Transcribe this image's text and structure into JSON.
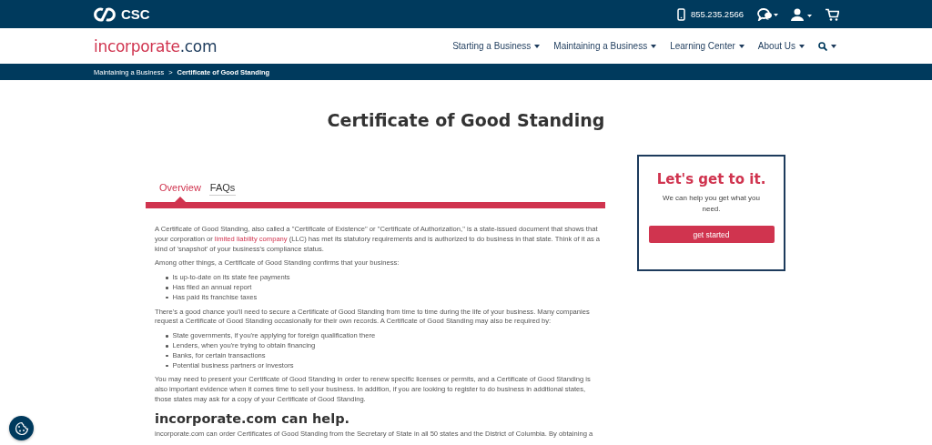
{
  "top_bar": {
    "logo": "CSC",
    "phone": "855.235.2566"
  },
  "nav": {
    "brand": [
      "incorporate",
      ".com"
    ],
    "items": [
      {
        "label": "Starting a Business"
      },
      {
        "label": "Maintaining a Business"
      },
      {
        "label": "Learning Center"
      },
      {
        "label": "About Us"
      }
    ]
  },
  "breadcrumb": {
    "separator": ">",
    "items": [
      {
        "label": "Maintaining a Business",
        "current": false
      },
      {
        "label": "Certificate of Good Standing",
        "current": true
      }
    ]
  },
  "title": "Certificate of Good Standing",
  "tabs": [
    {
      "label": "Overview",
      "selected": true
    },
    {
      "label": "FAQs",
      "selected": false
    }
  ],
  "content": [
    {
      "kind": "paragraph",
      "parts": [
        {
          "text": "A Certificate of Good Standing, also called a \"Certificate of Existence\" or \"Certificate of Authorization,\" is a state-issued document that shows that your corporation or ",
          "kind": "text"
        },
        {
          "text": "limited liability company",
          "kind": "link"
        },
        {
          "text": " (LLC) has met its statutory requirements and is authorized to do business in that state. Think of it as a kind of 'snapshot' of your business's compliance status.",
          "kind": "text"
        }
      ]
    },
    {
      "kind": "paragraph",
      "parts": [
        {
          "text": "Among other things, a Certificate of Good Standing confirms that your business:",
          "kind": "text"
        }
      ]
    },
    {
      "kind": "list",
      "items": [
        "Is up-to-date on its state fee payments",
        "Has filed an annual report",
        "Has paid its franchise taxes"
      ]
    },
    {
      "kind": "paragraph",
      "parts": [
        {
          "text": "There's a good chance you'll need to secure a Certificate of Good Standing from time to time during the life of your business. Many companies request a Certificate of Good Standing occasionally for their own records. A Certificate of Good Standing may also be required by:",
          "kind": "text"
        }
      ]
    },
    {
      "kind": "list",
      "items": [
        "State governments, if you're applying for foreign qualification there",
        "Lenders, when you're trying to obtain financing",
        "Banks, for certain transactions",
        "Potential business partners or investors"
      ]
    },
    {
      "kind": "paragraph",
      "parts": [
        {
          "text": "You may need to present your Certificate of Good Standing in order to renew specific licenses or permits, and a Certificate of Good Standing is also important evidence when it comes time to sell your business. In addition, if you are looking to register to do business in additional states, those states may ask for a copy of your Certificate of Good Standing.",
          "kind": "text"
        }
      ]
    },
    {
      "kind": "heading",
      "text": "incorporate.com can help."
    },
    {
      "kind": "paragraph",
      "parts": [
        {
          "text": "incorporate.com can order Certificates of Good Standing from the Secretary of State in all 50 states and the District of Columbia. By obtaining a",
          "kind": "text"
        }
      ]
    }
  ],
  "card": {
    "heading": "Let's get to it.",
    "text": "We can help you get what you need.",
    "button": "get started"
  }
}
